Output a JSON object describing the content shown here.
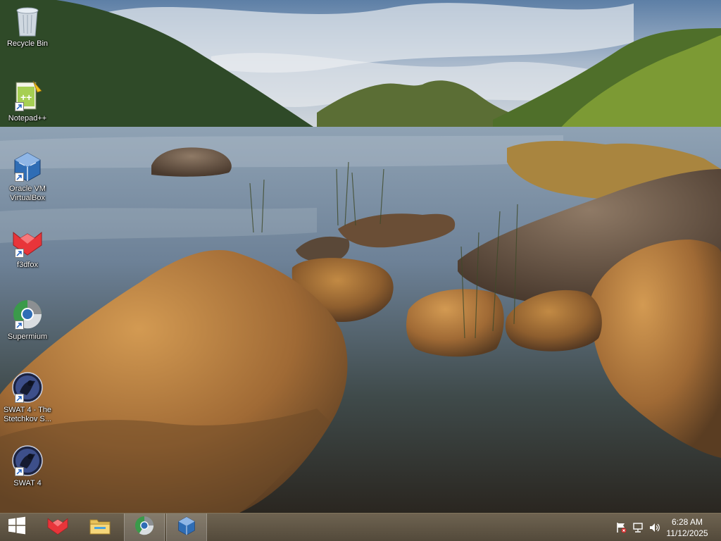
{
  "desktop": {
    "icons": [
      {
        "label": "Recycle Bin",
        "icon": "recycle-bin-icon",
        "shortcut": false
      },
      {
        "label": "Notepad++",
        "icon": "notepad-plus-plus-icon",
        "shortcut": true
      },
      {
        "label": "Oracle VM VirtualBox",
        "icon": "virtualbox-icon",
        "shortcut": true
      },
      {
        "label": "f3dfox",
        "icon": "f3dfox-icon",
        "shortcut": true
      },
      {
        "label": "Supermium",
        "icon": "supermium-icon",
        "shortcut": true
      },
      {
        "label": "SWAT 4 - The Stetchkov S...",
        "icon": "swat4-stetchkov-icon",
        "shortcut": true
      },
      {
        "label": "SWAT 4",
        "icon": "swat4-icon",
        "shortcut": true
      }
    ]
  },
  "taskbar": {
    "buttons": [
      {
        "name": "start-button",
        "icon": "windows-logo-icon",
        "active": false
      },
      {
        "name": "f3dfox-taskbar-button",
        "icon": "f3dfox-icon",
        "active": false
      },
      {
        "name": "file-explorer-taskbar-button",
        "icon": "folder-icon",
        "active": false
      },
      {
        "name": "supermium-taskbar-button",
        "icon": "supermium-icon",
        "active": true
      },
      {
        "name": "virtualbox-taskbar-button",
        "icon": "virtualbox-icon",
        "active": true
      }
    ],
    "tray": {
      "icons": [
        "action-center-flag-icon",
        "network-icon",
        "volume-icon"
      ]
    },
    "clock": {
      "time": "6:28 AM",
      "date": "11/12/2025"
    }
  },
  "colors": {
    "taskbar": "#5e5240",
    "label_text": "#ffffff",
    "f3dfox_red": "#e8353a",
    "virtualbox_blue": "#2f6db5"
  }
}
